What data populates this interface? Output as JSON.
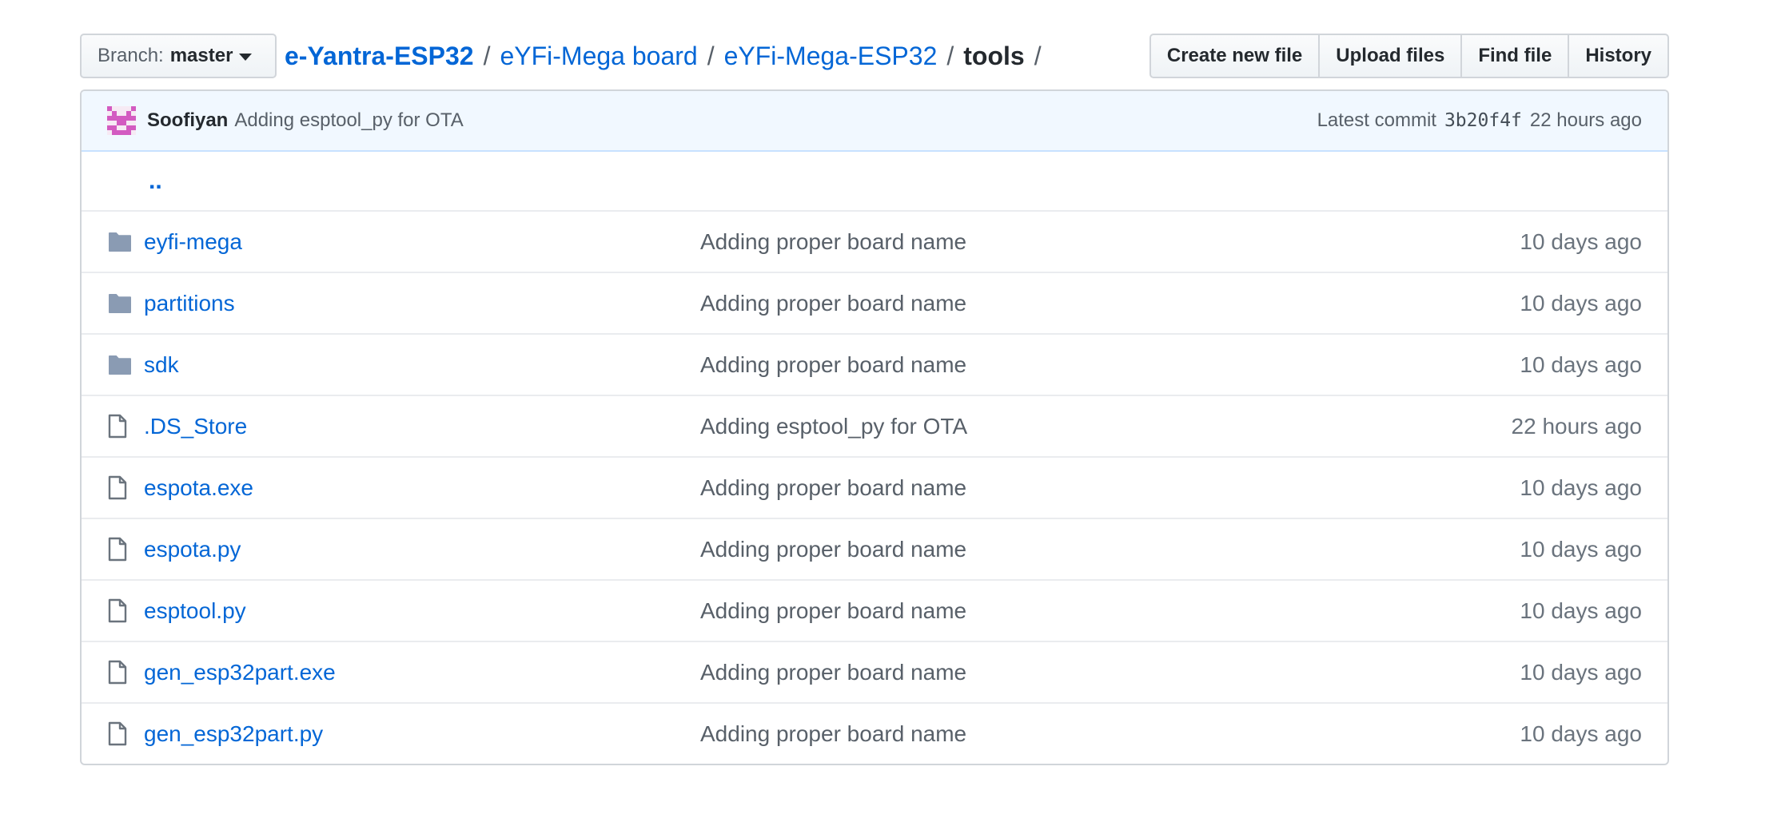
{
  "branch": {
    "prefix": "Branch:",
    "name": "master"
  },
  "breadcrumb": {
    "repo": "e-Yantra-ESP32",
    "sep": "/",
    "parts": [
      "eYFi-Mega board",
      "eYFi-Mega-ESP32"
    ],
    "current": "tools"
  },
  "actions": {
    "create_new_file": "Create new file",
    "upload_files": "Upload files",
    "find_file": "Find file",
    "history": "History"
  },
  "commit": {
    "author": "Soofiyan",
    "message": "Adding esptool_py for OTA",
    "latest_label": "Latest commit",
    "sha": "3b20f4f",
    "age": "22 hours ago"
  },
  "parent_dir": "..",
  "files": [
    {
      "type": "folder",
      "icon": "folder-icon",
      "name": "eyfi-mega",
      "message": "Adding proper board name",
      "age": "10 days ago"
    },
    {
      "type": "folder",
      "icon": "folder-icon",
      "name": "partitions",
      "message": "Adding proper board name",
      "age": "10 days ago"
    },
    {
      "type": "folder",
      "icon": "folder-icon",
      "name": "sdk",
      "message": "Adding proper board name",
      "age": "10 days ago"
    },
    {
      "type": "file",
      "icon": "file-icon",
      "name": ".DS_Store",
      "message": "Adding esptool_py for OTA",
      "age": "22 hours ago"
    },
    {
      "type": "file",
      "icon": "file-icon",
      "name": "espota.exe",
      "message": "Adding proper board name",
      "age": "10 days ago"
    },
    {
      "type": "file",
      "icon": "file-icon",
      "name": "espota.py",
      "message": "Adding proper board name",
      "age": "10 days ago"
    },
    {
      "type": "file",
      "icon": "file-icon",
      "name": "esptool.py",
      "message": "Adding proper board name",
      "age": "10 days ago"
    },
    {
      "type": "file",
      "icon": "file-icon",
      "name": "gen_esp32part.exe",
      "message": "Adding proper board name",
      "age": "10 days ago"
    },
    {
      "type": "file",
      "icon": "file-icon",
      "name": "gen_esp32part.py",
      "message": "Adding proper board name",
      "age": "10 days ago"
    }
  ],
  "colors": {
    "link": "#0366d6",
    "folder": "#79b8ff",
    "muted": "#586069",
    "commit_bg": "#f1f8ff",
    "avatar": "#d35bc1"
  }
}
